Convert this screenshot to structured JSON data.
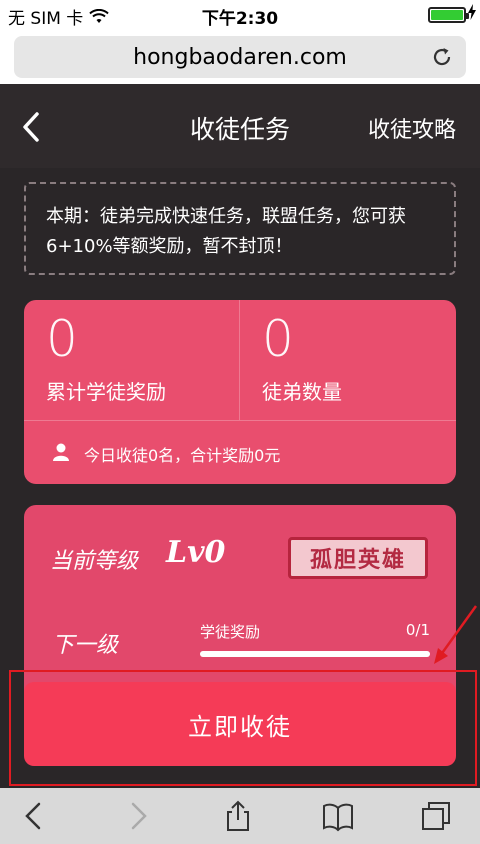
{
  "status_bar": {
    "carrier": "无 SIM 卡",
    "time": "下午2:30",
    "icons": [
      "wifi-icon",
      "battery-icon",
      "charging-icon"
    ]
  },
  "browser": {
    "url": "hongbaodaren.com",
    "toolbar_icons": [
      "back-icon",
      "forward-icon",
      "share-icon",
      "bookmarks-icon",
      "tabs-icon"
    ]
  },
  "header": {
    "title": "收徒任务",
    "right_link": "收徒攻略"
  },
  "notice": {
    "text": "本期：徒弟完成快速任务，联盟任务，您可获6+10%等额奖励，暂不封顶！"
  },
  "stats": {
    "reward_value": "0",
    "reward_label": "累计学徒奖励",
    "apprentice_value": "0",
    "apprentice_label": "徒弟数量",
    "summary": "今日收徒0名，合计奖励0元"
  },
  "level": {
    "current_label": "当前等级",
    "current_value": "Lv0",
    "badge": "孤胆英雄",
    "next_label": "下一级",
    "progress_label": "学徒奖励",
    "progress_count": "0/1",
    "progress_fraction": 1.0
  },
  "cta": {
    "label": "立即收徒"
  },
  "colors": {
    "background": "#2a2628",
    "card_pink": "#e94e6e",
    "cta_red": "#f53b57",
    "highlight_red": "#e01b22"
  }
}
